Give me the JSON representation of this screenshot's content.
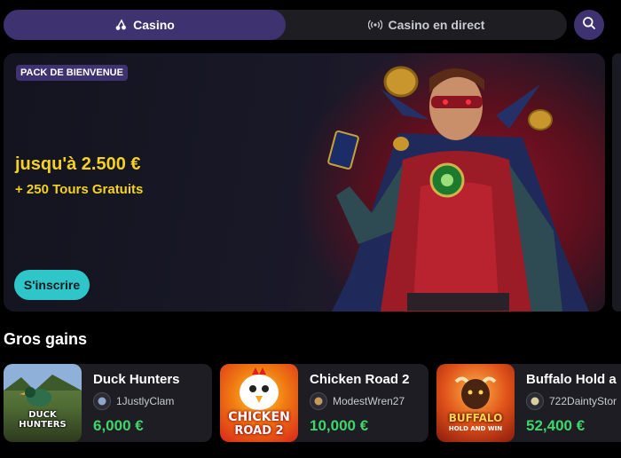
{
  "tabs": [
    {
      "label": "Casino",
      "active": true,
      "icon": "cherries-icon"
    },
    {
      "label": "Casino en direct",
      "active": false,
      "icon": "live-broadcast-icon"
    }
  ],
  "search": {
    "icon": "search-icon"
  },
  "banner": {
    "badge": "PACK DE BIENVENUE",
    "headline": "jusqu'à 2.500 €",
    "subline": "+ 250 Tours Gratuits",
    "cta": "S'inscrire"
  },
  "big_wins": {
    "title": "Gros gains",
    "items": [
      {
        "game": "Duck Hunters",
        "user": "1JustlyClam",
        "amount": "6,000 €",
        "thumb_text": "DUCK HUNTERS"
      },
      {
        "game": "Chicken Road 2",
        "user": "ModestWren27",
        "amount": "10,000 €",
        "thumb_text_1": "CHICKEN",
        "thumb_text_2": "ROAD 2"
      },
      {
        "game": "Buffalo Hold a",
        "user": "722DaintyStor",
        "amount": "52,400 €",
        "thumb_text_1": "BUFFALO",
        "thumb_text_2": "HOLD AND WIN"
      }
    ]
  },
  "colors": {
    "accent": "#3f3270",
    "cta": "#2ec6c9",
    "headline": "#f5d21f",
    "win_amount": "#3ed66b"
  }
}
